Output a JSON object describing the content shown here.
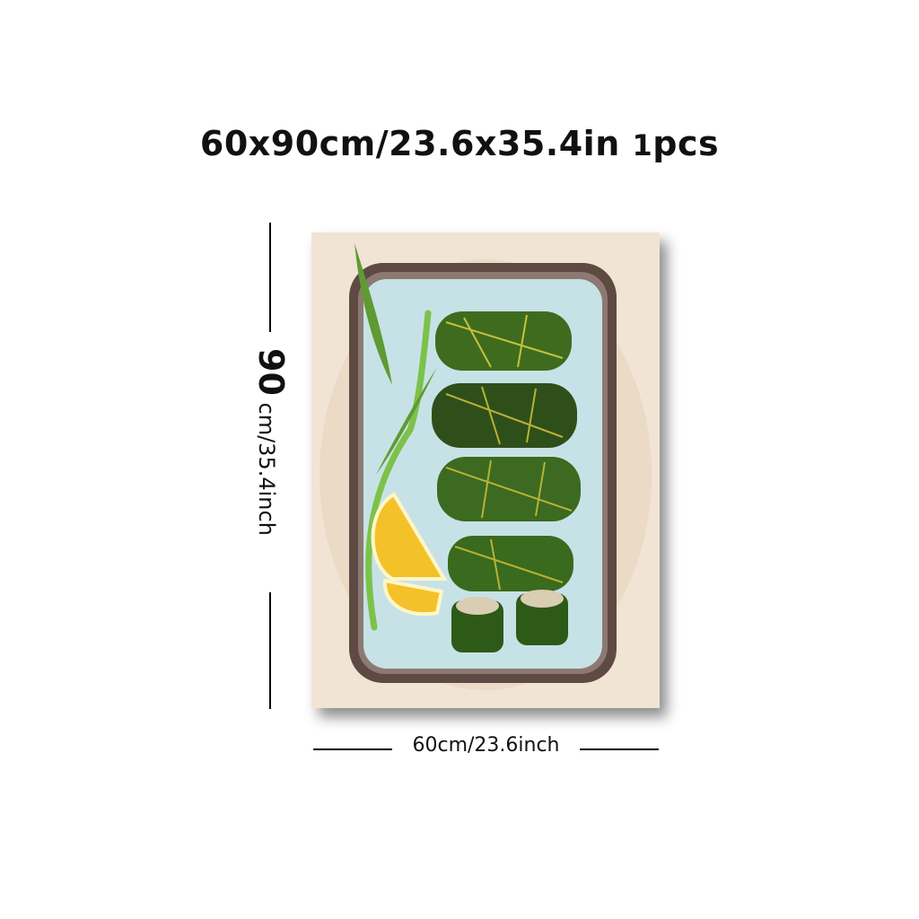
{
  "title": {
    "size_text": "60x90cm/23.6x35.4in",
    "qty_number": "1",
    "qty_unit": "pcs"
  },
  "dimensions": {
    "height_number": "90",
    "height_rest": " cm/35.4inch",
    "width_label": "60cm/23.6inch"
  },
  "colors": {
    "background": "#f2e6d8",
    "plate_rim": "#5e4a42",
    "plate_inner": "#c9e3e6",
    "leaf_green": "#3f6b1f",
    "lemon": "#f3c22a"
  }
}
